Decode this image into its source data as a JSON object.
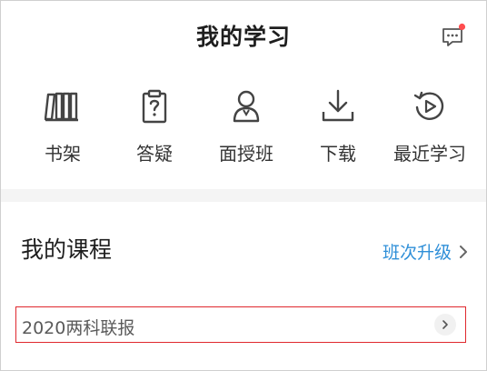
{
  "header": {
    "title": "我的学习",
    "message_icon": "message-dots-icon"
  },
  "quick_nav": [
    {
      "label": "书架",
      "icon": "bookshelf-icon"
    },
    {
      "label": "答疑",
      "icon": "clipboard-question-icon"
    },
    {
      "label": "面授班",
      "icon": "person-icon"
    },
    {
      "label": "下载",
      "icon": "download-icon"
    },
    {
      "label": "最近学习",
      "icon": "history-play-icon"
    }
  ],
  "courses": {
    "title": "我的课程",
    "upgrade_label": "班次升级",
    "items": [
      {
        "name": "2020两科联报"
      }
    ]
  },
  "colors": {
    "accent_blue": "#2f8fd8",
    "badge_red": "#ff4d4f",
    "highlight_red": "#e0282e",
    "icon_gray": "#444444"
  }
}
